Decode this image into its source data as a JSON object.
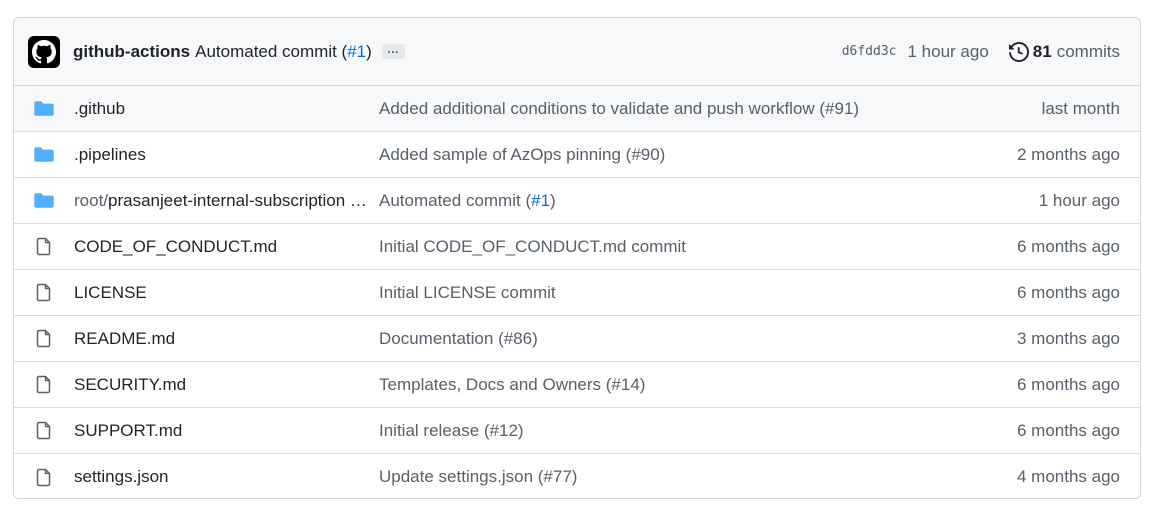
{
  "header": {
    "author": "github-actions",
    "commit_message_prefix": "Automated commit (",
    "commit_message_link": "#1",
    "commit_message_suffix": ")",
    "ellipsis": "…",
    "sha": "d6fdd3c",
    "time": "1 hour ago",
    "commit_count": "81",
    "commits_label": "commits",
    "history_icon": "history-icon"
  },
  "colors": {
    "folder": "#54aeff",
    "file_icon": "#57606a",
    "link": "#0969da",
    "muted": "#57606a",
    "border": "#d0d7de",
    "header_bg": "#f6f8fa"
  },
  "rows": [
    {
      "type": "folder",
      "name": ".github",
      "message": "Added additional conditions to validate and push workflow (#91)",
      "time": "last month"
    },
    {
      "type": "folder",
      "name": ".pipelines",
      "message": "Added sample of AzOps pinning (#90)",
      "time": "2 months ago"
    },
    {
      "type": "folder",
      "name_prefix": "root/",
      "name": "prasanjeet-internal-subscription …",
      "message_prefix": "Automated commit (",
      "message_link": "#1",
      "message_suffix": ")",
      "time": "1 hour ago"
    },
    {
      "type": "file",
      "name": "CODE_OF_CONDUCT.md",
      "message": "Initial CODE_OF_CONDUCT.md commit",
      "time": "6 months ago"
    },
    {
      "type": "file",
      "name": "LICENSE",
      "message": "Initial LICENSE commit",
      "time": "6 months ago"
    },
    {
      "type": "file",
      "name": "README.md",
      "message": "Documentation (#86)",
      "time": "3 months ago"
    },
    {
      "type": "file",
      "name": "SECURITY.md",
      "message": "Templates, Docs and Owners (#14)",
      "time": "6 months ago"
    },
    {
      "type": "file",
      "name": "SUPPORT.md",
      "message": "Initial release (#12)",
      "time": "6 months ago"
    },
    {
      "type": "file",
      "name": "settings.json",
      "message": "Update settings.json (#77)",
      "time": "4 months ago"
    }
  ]
}
